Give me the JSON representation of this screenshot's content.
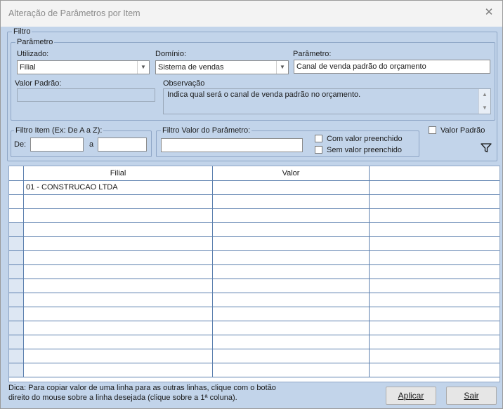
{
  "window": {
    "title": "Alteração de Parâmetros por Item"
  },
  "filtro": {
    "label": "Filtro",
    "parametro_group": {
      "label": "Parâmetro",
      "utilizado_label": "Utilizado:",
      "utilizado_value": "Filial",
      "dominio_label": "Domínio:",
      "dominio_value": "Sistema de vendas",
      "parametro_label": "Parâmetro:",
      "parametro_value": "Canal de venda padrão do orçamento",
      "valor_padrao_label": "Valor Padrão:",
      "valor_padrao_value": "",
      "observacao_label": "Observação",
      "observacao_value": "Indica qual será o canal de venda padrão no orçamento."
    },
    "filtro_item": {
      "label": "Filtro Item (Ex: De A a Z):",
      "de_label": "De:",
      "de_value": "",
      "a_label": "a",
      "a_value": ""
    },
    "filtro_valor": {
      "label": "Filtro Valor do Parâmetro:",
      "value": "",
      "com_valor_label": "Com valor preenchido",
      "com_valor_checked": false,
      "sem_valor_label": "Sem valor preenchido",
      "sem_valor_checked": false
    },
    "valor_padrao_check_label": "Valor Padrão",
    "valor_padrao_checked": false,
    "filter_icon": "funnel-icon"
  },
  "grid": {
    "columns": [
      "Filial",
      "Valor",
      ""
    ],
    "rows": [
      [
        "01 - CONSTRUCAO LTDA",
        "",
        ""
      ],
      [
        "",
        "",
        ""
      ],
      [
        "",
        "",
        ""
      ],
      [
        "",
        "",
        ""
      ],
      [
        "",
        "",
        ""
      ],
      [
        "",
        "",
        ""
      ],
      [
        "",
        "",
        ""
      ],
      [
        "",
        "",
        ""
      ],
      [
        "",
        "",
        ""
      ],
      [
        "",
        "",
        ""
      ],
      [
        "",
        "",
        ""
      ],
      [
        "",
        "",
        ""
      ],
      [
        "",
        "",
        ""
      ],
      [
        "",
        "",
        ""
      ]
    ]
  },
  "footer": {
    "hint_line1": "Dica: Para copiar valor de uma linha para as outras linhas, clique com o botão",
    "hint_line2": "direito do mouse sobre a linha desejada (clique sobre a 1ª coluna).",
    "apply_label": "Aplicar",
    "exit_label": "Sair"
  }
}
